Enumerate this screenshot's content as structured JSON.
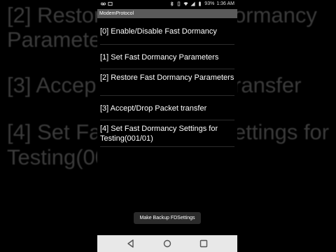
{
  "background": {
    "left_lines": [
      "[2] Restore",
      "Parameter",
      "[3] Accep",
      "[4] Set Fas",
      "Testing(00"
    ],
    "right_lines": [
      "ormancy",
      "ransfer",
      "ettings for"
    ]
  },
  "status_bar": {
    "battery": "93%",
    "time": "1:36 AM"
  },
  "app": {
    "title": "ModemProtocol",
    "items": [
      {
        "label": "[0] Enable/Disable Fast Dormancy"
      },
      {
        "label": "[1] Set Fast Dormancy Parameters"
      },
      {
        "label": "[2] Restore Fast Dormancy Parameters"
      },
      {
        "label": "[3] Accept/Drop Packet transfer"
      },
      {
        "label": "[4] Set Fast Dormancy Settings for Testing(001/01)"
      }
    ]
  },
  "toast": {
    "text": "Make Backup FDSettings"
  },
  "colors": {
    "title_bar": "#5a5a5a",
    "background": "#000000",
    "nav_bar": "#e8e8e8"
  }
}
